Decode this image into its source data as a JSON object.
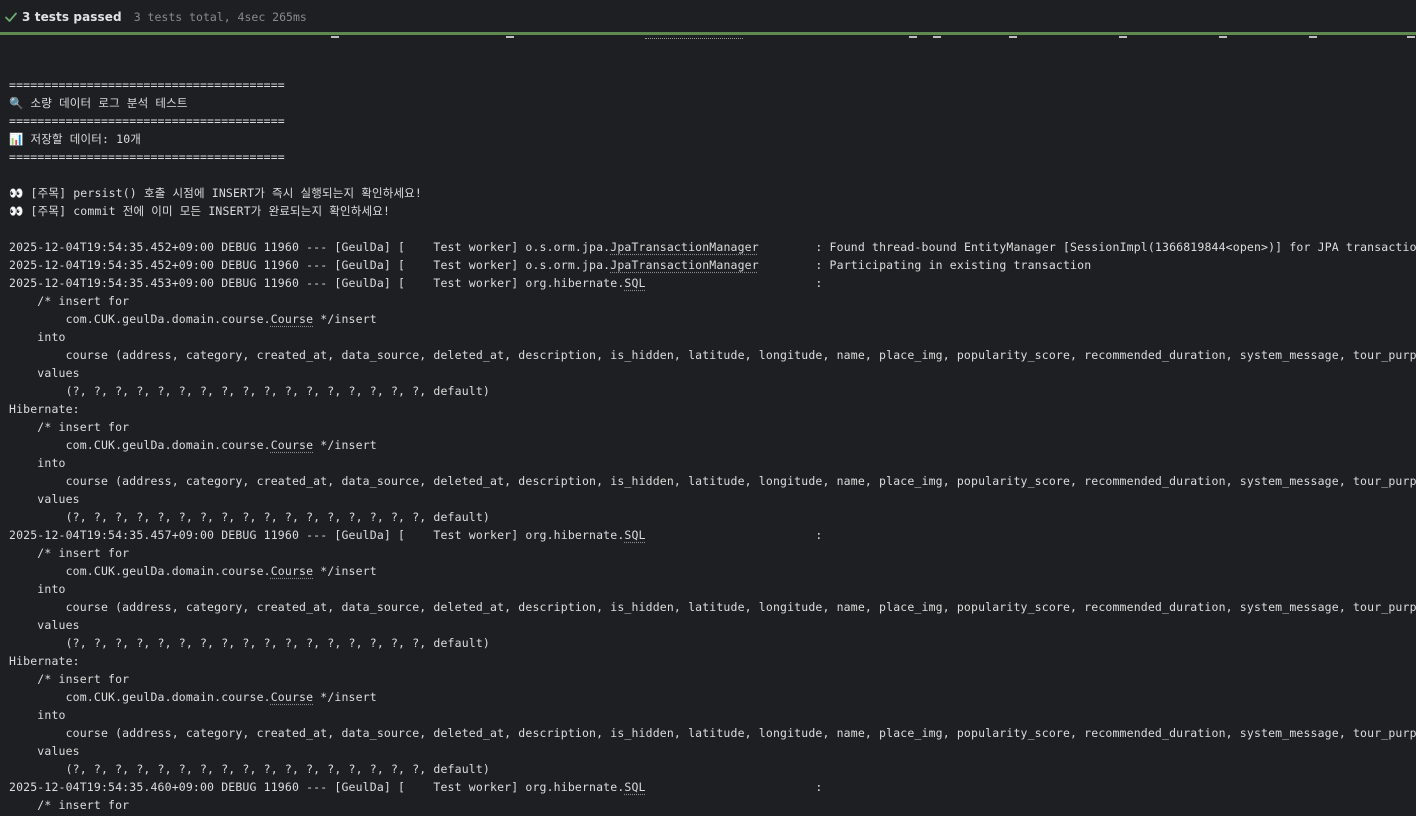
{
  "test_status": {
    "passed_text": "3 tests passed",
    "summary_text": "3 tests total, 4sec 265ms",
    "check_icon_color": "#6aab73",
    "progress_color": "#5e8a50"
  },
  "console": {
    "lines": [
      "",
      "=======================================",
      "🔍 소량 데이터 로그 분석 테스트",
      "=======================================",
      "📊 저장할 데이터: 10개",
      "=======================================",
      "",
      "👀 [주목] persist() 호출 시점에 INSERT가 즉시 실행되는지 확인하세요!",
      "👀 [주목] commit 전에 이미 모든 INSERT가 완료되는지 확인하세요!",
      "",
      "2025-12-04T19:54:35.452+09:00 DEBUG 11960 --- [GeulDa] [    Test worker] o.s.orm.jpa.JpaTransactionManager        : Found thread-bound EntityManager [SessionImpl(1366819844<open>)] for JPA transaction",
      "2025-12-04T19:54:35.452+09:00 DEBUG 11960 --- [GeulDa] [    Test worker] o.s.orm.jpa.JpaTransactionManager        : Participating in existing transaction",
      "2025-12-04T19:54:35.453+09:00 DEBUG 11960 --- [GeulDa] [    Test worker] org.hibernate.SQL                        : ",
      "    /* insert for",
      "        com.CUK.geulDa.domain.course.Course */insert ",
      "    into",
      "        course (address, category, created_at, data_source, deleted_at, description, is_hidden, latitude, longitude, name, place_img, popularity_score, recommended_duration, system_message, tour_purpose",
      "    values",
      "        (?, ?, ?, ?, ?, ?, ?, ?, ?, ?, ?, ?, ?, ?, ?, ?, ?, default)",
      "Hibernate: ",
      "    /* insert for",
      "        com.CUK.geulDa.domain.course.Course */insert ",
      "    into",
      "        course (address, category, created_at, data_source, deleted_at, description, is_hidden, latitude, longitude, name, place_img, popularity_score, recommended_duration, system_message, tour_purpose",
      "    values",
      "        (?, ?, ?, ?, ?, ?, ?, ?, ?, ?, ?, ?, ?, ?, ?, ?, ?, default)",
      "2025-12-04T19:54:35.457+09:00 DEBUG 11960 --- [GeulDa] [    Test worker] org.hibernate.SQL                        : ",
      "    /* insert for",
      "        com.CUK.geulDa.domain.course.Course */insert ",
      "    into",
      "        course (address, category, created_at, data_source, deleted_at, description, is_hidden, latitude, longitude, name, place_img, popularity_score, recommended_duration, system_message, tour_purpose",
      "    values",
      "        (?, ?, ?, ?, ?, ?, ?, ?, ?, ?, ?, ?, ?, ?, ?, ?, ?, default)",
      "Hibernate: ",
      "    /* insert for",
      "        com.CUK.geulDa.domain.course.Course */insert ",
      "    into",
      "        course (address, category, created_at, data_source, deleted_at, description, is_hidden, latitude, longitude, name, place_img, popularity_score, recommended_duration, system_message, tour_purpose",
      "    values",
      "        (?, ?, ?, ?, ?, ?, ?, ?, ?, ?, ?, ?, ?, ?, ?, ?, ?, default)",
      "2025-12-04T19:54:35.460+09:00 DEBUG 11960 --- [GeulDa] [    Test worker] org.hibernate.SQL                        : ",
      "    /* insert for",
      "        com.CUK.geulDa.domain.course.Course */insert "
    ],
    "text_color": "#dcdcdc"
  }
}
